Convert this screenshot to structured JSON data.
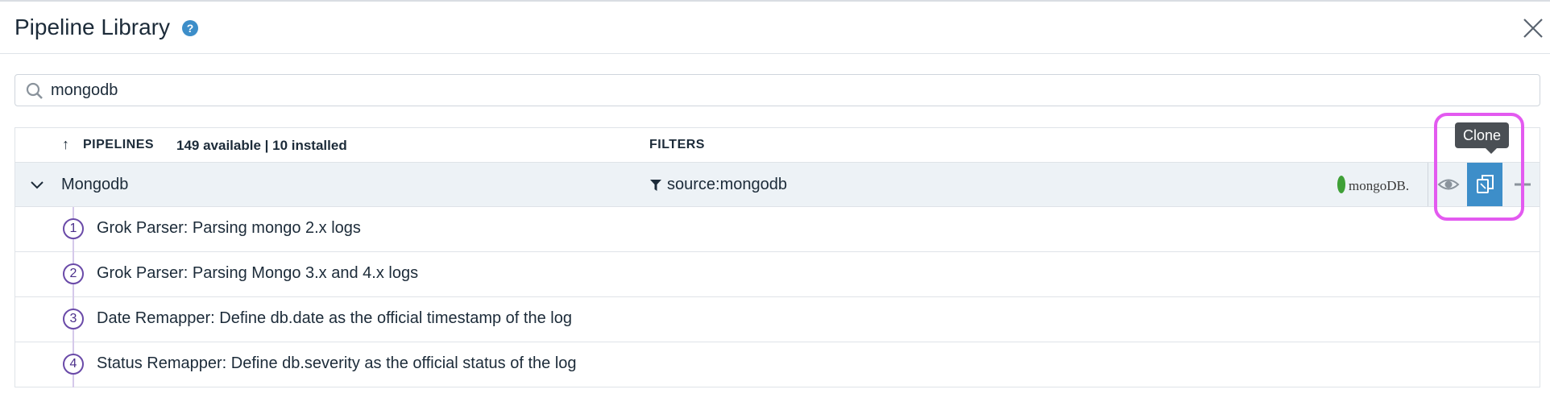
{
  "header": {
    "title": "Pipeline Library",
    "help_icon": "question-circle-icon",
    "close_icon": "close-icon"
  },
  "search": {
    "value": "mongodb",
    "icon": "search-icon"
  },
  "table": {
    "sort_icon": "arrow-up-icon",
    "col_pipelines": "PIPELINES",
    "count_text": "149 available | 10 installed",
    "col_filters": "FILTERS"
  },
  "pipeline": {
    "name": "Mongodb",
    "filter_icon": "funnel-icon",
    "filter": "source:mongodb",
    "logo_text": "mongoDB.",
    "actions": {
      "view_icon": "eye-icon",
      "clone_icon": "clone-icon",
      "add_icon": "plus-icon"
    }
  },
  "tooltip": {
    "text": "Clone"
  },
  "steps": [
    {
      "num": "1",
      "text": "Grok Parser: Parsing mongo 2.x logs"
    },
    {
      "num": "2",
      "text": "Grok Parser: Parsing Mongo 3.x and 4.x logs"
    },
    {
      "num": "3",
      "text": "Date Remapper: Define db.date as the official timestamp of the log"
    },
    {
      "num": "4",
      "text": "Status Remapper: Define db.severity as the official status of the log"
    }
  ],
  "colors": {
    "accent": "#3d8ec9",
    "highlight": "#e35af0",
    "step": "#6a4aa8",
    "row_bg": "#edf2f6"
  }
}
